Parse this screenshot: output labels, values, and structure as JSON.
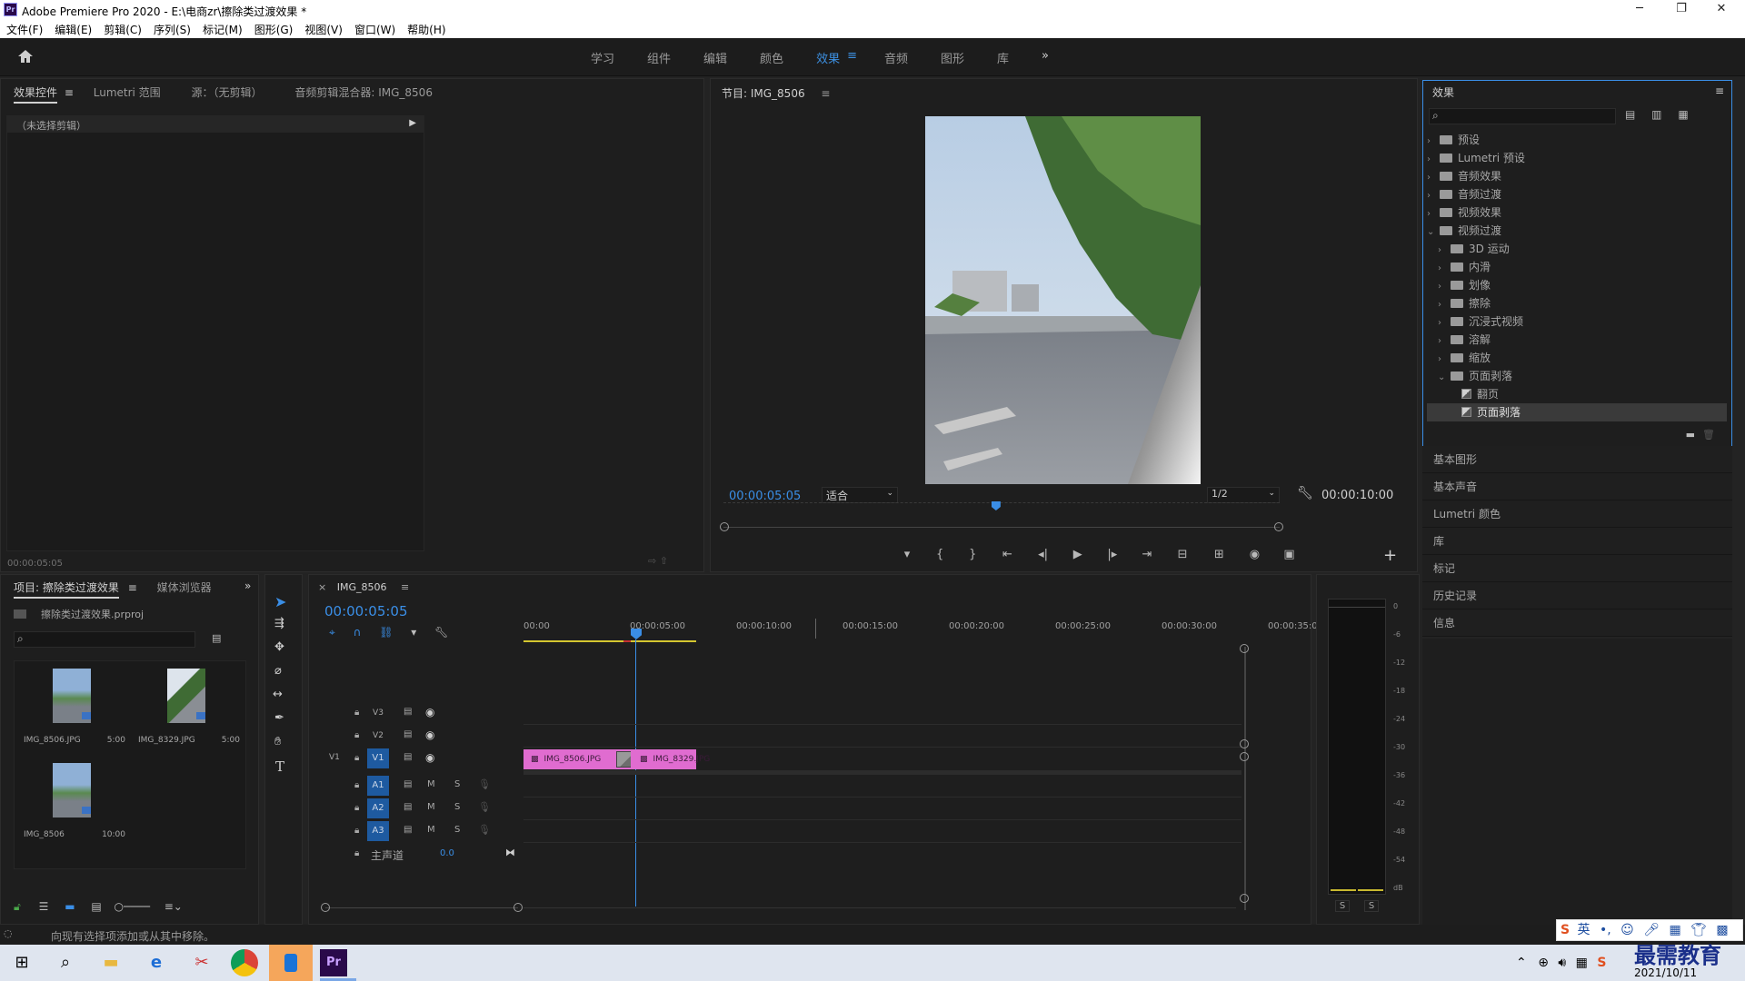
{
  "window": {
    "title": "Adobe Premiere Pro 2020 - E:\\电商zr\\擦除类过渡效果 *",
    "app_icon": "Pr",
    "minimize": "─",
    "maximize": "❐",
    "close": "✕"
  },
  "menu": [
    "文件(F)",
    "编辑(E)",
    "剪辑(C)",
    "序列(S)",
    "标记(M)",
    "图形(G)",
    "视图(V)",
    "窗口(W)",
    "帮助(H)"
  ],
  "workspaces": {
    "items": [
      "学习",
      "组件",
      "编辑",
      "颜色",
      "效果",
      "音频",
      "图形",
      "库"
    ],
    "active": "效果",
    "more": "»"
  },
  "source_panel": {
    "tabs": [
      "效果控件",
      "Lumetri 范围",
      "源：（无剪辑）",
      "音频剪辑混合器: IMG_8506"
    ],
    "no_clip": "（未选择剪辑）",
    "timecode": "00:00:05:05"
  },
  "program": {
    "title": "节目: IMG_8506",
    "timecode": "00:00:05:05",
    "fit": "适合",
    "quality": "1/2",
    "duration": "00:00:10:00",
    "playhead_pct": 49
  },
  "effects_panel": {
    "title": "效果",
    "tree": [
      {
        "label": "预设",
        "level": 0,
        "type": "folder-star",
        "open": false
      },
      {
        "label": "Lumetri 预设",
        "level": 0,
        "type": "folder-star",
        "open": false
      },
      {
        "label": "音频效果",
        "level": 0,
        "type": "folder",
        "open": false
      },
      {
        "label": "音频过渡",
        "level": 0,
        "type": "folder",
        "open": false
      },
      {
        "label": "视频效果",
        "level": 0,
        "type": "folder",
        "open": false
      },
      {
        "label": "视频过渡",
        "level": 0,
        "type": "folder",
        "open": true
      },
      {
        "label": "3D 运动",
        "level": 1,
        "type": "folder",
        "open": false
      },
      {
        "label": "内滑",
        "level": 1,
        "type": "folder",
        "open": false
      },
      {
        "label": "划像",
        "level": 1,
        "type": "folder",
        "open": false
      },
      {
        "label": "擦除",
        "level": 1,
        "type": "folder",
        "open": false
      },
      {
        "label": "沉浸式视频",
        "level": 1,
        "type": "folder",
        "open": false
      },
      {
        "label": "溶解",
        "level": 1,
        "type": "folder",
        "open": false
      },
      {
        "label": "缩放",
        "level": 1,
        "type": "folder",
        "open": false
      },
      {
        "label": "页面剥落",
        "level": 1,
        "type": "folder",
        "open": true
      },
      {
        "label": "翻页",
        "level": 2,
        "type": "effect",
        "open": false
      },
      {
        "label": "页面剥落",
        "level": 2,
        "type": "effect",
        "open": false,
        "selected": true
      }
    ]
  },
  "right_panels": [
    "基本图形",
    "基本声音",
    "Lumetri 颜色",
    "库",
    "标记",
    "历史记录",
    "信息"
  ],
  "project": {
    "tabs": [
      "项目: 擦除类过渡效果",
      "媒体浏览器"
    ],
    "file": "擦除类过渡效果.prproj",
    "items": [
      {
        "name": "IMG_8506.JPG",
        "dur": "5:00"
      },
      {
        "name": "IMG_8329.JPG",
        "dur": "5:00"
      },
      {
        "name": "IMG_8506",
        "dur": "10:00"
      }
    ]
  },
  "timeline": {
    "tab": "IMG_8506",
    "timecode": "00:00:05:05",
    "ruler": [
      "00:00",
      "00:00:05:00",
      "00:00:10:00",
      "00:00:15:00",
      "00:00:20:00",
      "00:00:25:00",
      "00:00:30:00",
      "00:00:35:0"
    ],
    "video_tracks": [
      "V3",
      "V2",
      "V1"
    ],
    "audio_tracks": [
      "A1",
      "A2",
      "A3"
    ],
    "source_label": "V1",
    "m": "M",
    "s": "S",
    "master": "主声道",
    "master_val": "0.0",
    "clips": [
      "IMG_8506.JPG",
      "IMG_8329.JPG"
    ]
  },
  "meter": {
    "scale": [
      "0",
      "-6",
      "-12",
      "-18",
      "-24",
      "-30",
      "-36",
      "-42",
      "-48",
      "-54",
      "dB"
    ],
    "solo": [
      "S",
      "S"
    ]
  },
  "status": "向现有选择项添加或从其中移除。",
  "taskbar": {
    "ime": "英",
    "date": "2021/10/11",
    "watermark": "最需教育"
  }
}
